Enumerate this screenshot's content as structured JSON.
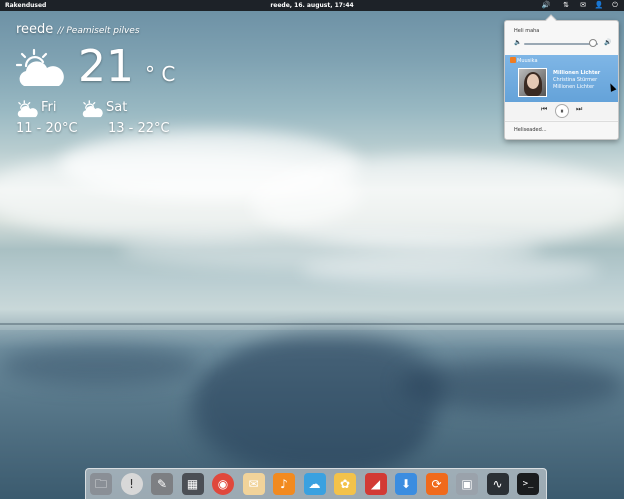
{
  "panel": {
    "applications_label": "Rakendused",
    "clock": "reede, 16. august, 17:44",
    "indicators": [
      {
        "name": "volume-icon",
        "glyph": "🔊"
      },
      {
        "name": "network-icon",
        "glyph": "⇅"
      },
      {
        "name": "mail-icon",
        "glyph": "✉"
      },
      {
        "name": "user-icon",
        "glyph": "👤"
      },
      {
        "name": "power-icon",
        "glyph": "⏻"
      }
    ]
  },
  "weather": {
    "day": "reede",
    "condition": "// Peamiselt pilves",
    "temperature": "21",
    "unit": "° C",
    "forecast": [
      {
        "day": "Fri",
        "range": "11 - 20°C"
      },
      {
        "day": "Sat",
        "range": "13 - 22°C"
      }
    ]
  },
  "sound_menu": {
    "output_label": "Heli maha",
    "volume_level": 0.93,
    "player_name": "Muusika",
    "track_title": "Millionen Lichter",
    "track_artist": "Christina Stürmer",
    "track_album": "Millionen Lichter",
    "settings_label": "Heliseaded..."
  },
  "dock": {
    "items": [
      {
        "name": "files-icon",
        "color": "#8a8f96",
        "glyph": "🗀"
      },
      {
        "name": "notifications-icon",
        "color": "#d8d8d8",
        "glyph": "!"
      },
      {
        "name": "text-editor-icon",
        "color": "#7d7f83",
        "glyph": "✎"
      },
      {
        "name": "calculator-icon",
        "color": "#4b4f55",
        "glyph": "▦"
      },
      {
        "name": "chrome-icon",
        "color": "#e0483c",
        "glyph": "◉"
      },
      {
        "name": "mail-app-icon",
        "color": "#f1d39a",
        "glyph": "✉"
      },
      {
        "name": "music-icon",
        "color": "#f28a1f",
        "glyph": "♪"
      },
      {
        "name": "cloud-sync-icon",
        "color": "#3aa1e0",
        "glyph": "☁"
      },
      {
        "name": "shotwell-icon",
        "color": "#f3c24a",
        "glyph": "✿"
      },
      {
        "name": "office-icon",
        "color": "#d23a35",
        "glyph": "◢"
      },
      {
        "name": "software-center-icon",
        "color": "#3b8de0",
        "glyph": "⬇"
      },
      {
        "name": "update-manager-icon",
        "color": "#f06a1c",
        "glyph": "⟳"
      },
      {
        "name": "workspaces-icon",
        "color": "#9aa2ab",
        "glyph": "▣"
      },
      {
        "name": "system-monitor-icon",
        "color": "#2b3035",
        "glyph": "∿"
      },
      {
        "name": "terminal-icon",
        "color": "#1a1c1e",
        "glyph": ">_"
      }
    ]
  }
}
